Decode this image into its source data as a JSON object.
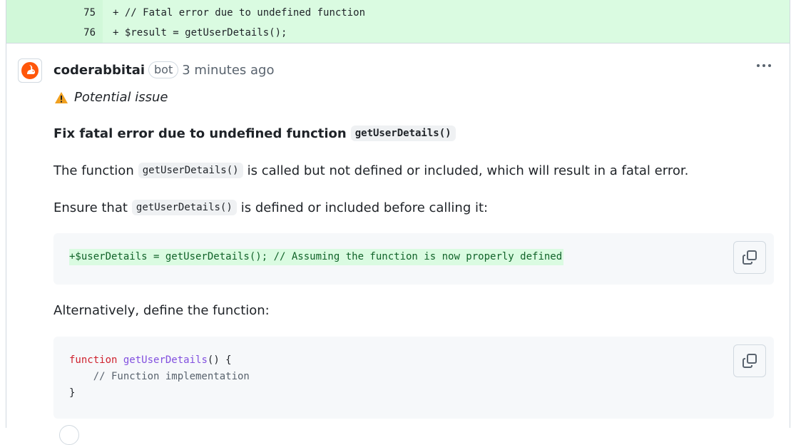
{
  "diff": {
    "lines": [
      {
        "number": "75",
        "marker": "+",
        "code": " // Fatal error due to undefined function"
      },
      {
        "number": "76",
        "marker": "+",
        "code": " $result = getUserDetails();"
      }
    ],
    "added_bg": "#dafbe1"
  },
  "comment": {
    "avatar_icon": "coderabbit-logo-icon",
    "author": "coderabbitai",
    "badge": "bot",
    "timestamp": "3 minutes ago",
    "menu_icon": "kebab-horizontal-icon",
    "issue_label": "Potential issue",
    "issue_icon": "warning-icon",
    "title": {
      "text": "Fix fatal error due to undefined function",
      "code": "getUserDetails()"
    },
    "paragraph1": {
      "before": "The function",
      "code": "getUserDetails()",
      "after": "is called but not defined or included, which will result in a fatal error."
    },
    "paragraph2": {
      "before": "Ensure that",
      "code": "getUserDetails()",
      "after": "is defined or included before calling it:"
    },
    "codeblock1": {
      "line": "+$userDetails = getUserDetails(); // Assuming the function is now properly defined",
      "copy_icon": "copy-icon"
    },
    "paragraph3": "Alternatively, define the function:",
    "codeblock2": {
      "keyword": "function",
      "fn_name": "getUserDetails",
      "sig_rest": "() {",
      "comment_line": "    // Function implementation",
      "close": "}",
      "copy_icon": "copy-icon"
    }
  },
  "colors": {
    "accent_orange": "#ff570a",
    "warning": "#f0a020",
    "keyword": "#cf222e",
    "function": "#8250df",
    "diff_add_text": "#116329"
  }
}
